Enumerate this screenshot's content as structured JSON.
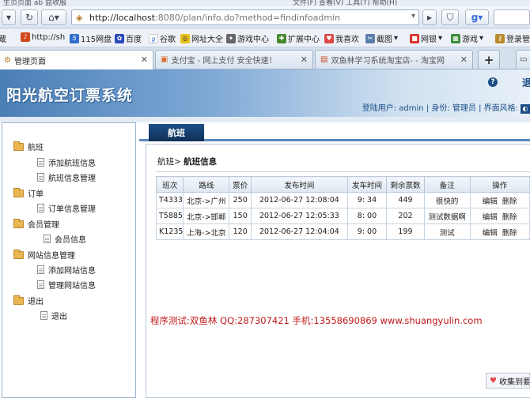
{
  "browser": {
    "top_clip_left": "生页页面 ab 益收服",
    "top_clip_right": "文件(F)  查看(V)  工具(T)  帮助(H)",
    "url_host": "http://localhost",
    "url_rest": ":8080/plan/info.do?method=findinfoadmin",
    "bookmarks": [
      "http://sh",
      "115网盘",
      "百度",
      "谷歌",
      "网址大全",
      "游戏中心",
      "扩展中心",
      "我喜欢",
      "截图",
      "网银",
      "游戏",
      "登录管"
    ],
    "tabs": [
      "管理页面",
      "支付宝 - 网上支付 安全快速！",
      "双鱼林学习系统淘宝店- - 淘宝网"
    ],
    "new_tab": "+"
  },
  "app": {
    "title": "阳光航空订票系统",
    "help": "?",
    "exit": "退",
    "user_info": "登陆用户: admin | 身份: 管理员 | 界面风格:"
  },
  "sidebar": {
    "groups": [
      {
        "label": "航班",
        "items": [
          "添加航班信息",
          "航班信息管理"
        ]
      },
      {
        "label": "订单",
        "items": [
          "订单信息管理"
        ]
      },
      {
        "label": "会员管理",
        "items": [
          "会员信息"
        ]
      },
      {
        "label": "网站信息管理",
        "items": [
          "添加网站信息",
          "管理网站信息"
        ]
      },
      {
        "label": "退出",
        "items": [
          "退出"
        ]
      }
    ]
  },
  "main": {
    "tab": "航班",
    "breadcrumb_parent": "航班>",
    "breadcrumb_current": "航班信息",
    "columns": [
      "班次",
      "路线",
      "票价",
      "发布时间",
      "发车时间",
      "剩余票数",
      "备注",
      "操作"
    ],
    "rows": [
      {
        "code": "T4333",
        "route": "北京->广州",
        "price": "250",
        "published": "2012-06-27 12:08:04",
        "depart": "9: 34",
        "remaining": "449",
        "note": "很快的",
        "edit": "编辑",
        "delete": "删除"
      },
      {
        "code": "T5885",
        "route": "北京->邯郸",
        "price": "150",
        "published": "2012-06-27 12:05:33",
        "depart": "8: 00",
        "remaining": "202",
        "note": "测试数据啊",
        "edit": "编辑",
        "delete": "删除"
      },
      {
        "code": "K1235",
        "route": "上海->北京",
        "price": "120",
        "published": "2012-06-27 12:04:04",
        "depart": "9: 00",
        "remaining": "199",
        "note": "测试",
        "edit": "编辑",
        "delete": "删除"
      }
    ]
  },
  "footer_note": "程序测试:双鱼林 QQ:287307421 手机:13558690869 www.shuangyulin.com",
  "favorite": "收集到要",
  "colors": {
    "accent": "#1e4f86",
    "note": "#c01818",
    "header": "#4a7fb6"
  }
}
